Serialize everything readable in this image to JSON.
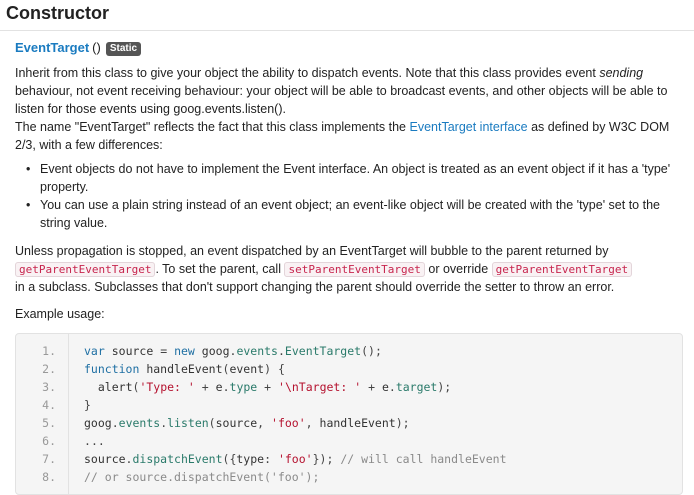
{
  "header": {
    "title": "Constructor"
  },
  "signature": {
    "name": "EventTarget",
    "parens": "()",
    "badge": "Static"
  },
  "description": {
    "p1_pre": "Inherit from this class to give your object the ability to dispatch events. Note that this class provides event ",
    "p1_em": "sending",
    "p1_post": " behaviour, not event receiving behaviour: your object will be able to broadcast events, and other objects will be able to listen for those events using goog.events.listen().",
    "p2_pre": "The name \"EventTarget\" reflects the fact that this class implements the ",
    "p2_link": "EventTarget interface",
    "p2_post": " as defined by W3C DOM 2/3, with a few differences:",
    "bullets": [
      "Event objects do not have to implement the Event interface. An object is treated as an event object if it has a 'type' property.",
      "You can use a plain string instead of an event object; an event-like object will be created with the 'type' set to the string value."
    ],
    "p3_a": "Unless propagation is stopped, an event dispatched by an EventTarget will bubble to the parent returned by",
    "p3_code1": "getParentEventTarget",
    "p3_b": ". To set the parent, call ",
    "p3_code2": "setParentEventTarget",
    "p3_c": " or override ",
    "p3_code3": "getParentEventTarget",
    "p3_d": "in a subclass. Subclasses that don't support changing the parent should override the setter to throw an error.",
    "p4": "Example usage:"
  },
  "code": {
    "line_numbers": [
      "1.",
      "2.",
      "3.",
      "4.",
      "5.",
      "6.",
      "7.",
      "8."
    ],
    "lines": [
      "var source = new goog.events.EventTarget();",
      "function handleEvent(event) {",
      "  alert('Type: ' + e.type + '\\nTarget: ' + e.target);",
      "}",
      "goog.events.listen(source, 'foo', handleEvent);",
      "...",
      "source.dispatchEvent({type: 'foo'}); // will call handleEvent",
      "// or source.dispatchEvent('foo');"
    ]
  }
}
